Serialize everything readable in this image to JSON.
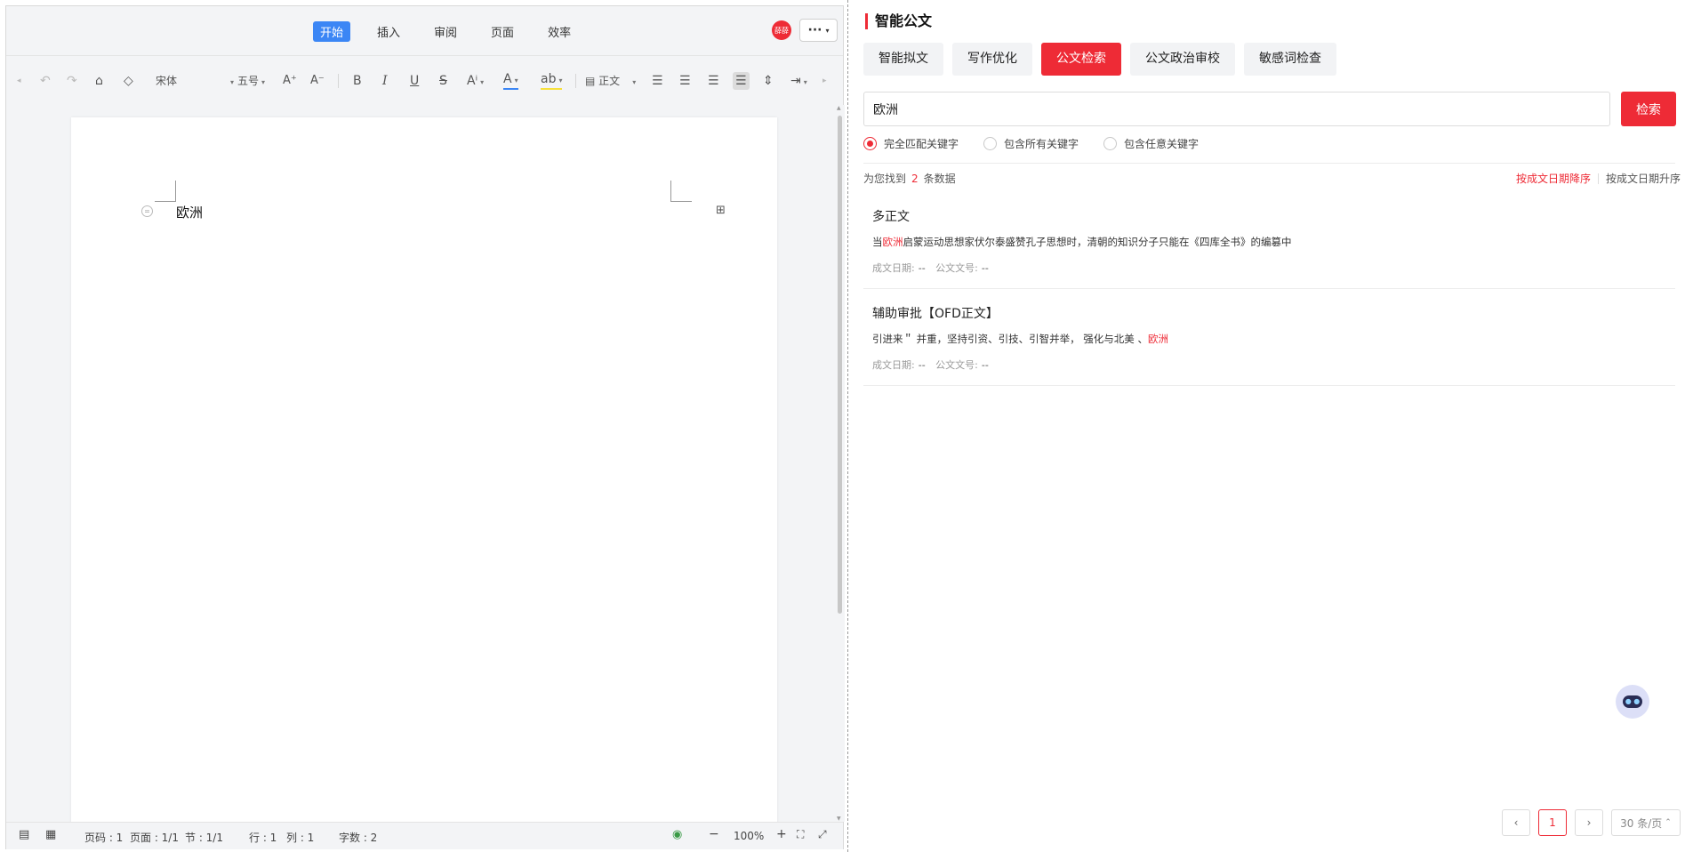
{
  "editor": {
    "menu_tabs": [
      "开始",
      "插入",
      "审阅",
      "页面",
      "效率"
    ],
    "avatar_text": "薛薛",
    "more_label": "···",
    "toolbar": {
      "font_name": "宋体",
      "font_size": "五号",
      "increase_font": "A⁺",
      "decrease_font": "A⁻",
      "bold": "B",
      "italic": "I",
      "underline": "U",
      "strike": "S",
      "superscript": "Aⁱ",
      "font_color": "A",
      "highlight": "ab",
      "style_label": "正文"
    },
    "document_text": "欧洲",
    "status": {
      "page_num": "页码 : 1",
      "pages": "页面 : 1/1",
      "section": "节 : 1/1",
      "row": "行 : 1",
      "col": "列 : 1",
      "word_count": "字数 : 2",
      "zoom_out": "−",
      "zoom": "100%",
      "zoom_in": "+"
    }
  },
  "panel": {
    "title": "智能公文",
    "tabs": [
      "智能拟文",
      "写作优化",
      "公文检索",
      "公文政治审校",
      "敏感词检查"
    ],
    "active_tab": "公文检索",
    "search": {
      "value": "欧洲",
      "button_label": "检索"
    },
    "match_modes": [
      "完全匹配关键字",
      "包含所有关键字",
      "包含任意关键字"
    ],
    "selected_mode": "完全匹配关键字",
    "result_prefix": "为您找到",
    "result_count": "2",
    "result_suffix": "条数据",
    "sort_desc": "按成文日期降序",
    "sort_asc": "按成文日期升序",
    "results": [
      {
        "title": "多正文",
        "snippet_before": "当",
        "snippet_hl": "欧洲",
        "snippet_after": "启蒙运动思想家伏尔泰盛赞孔子思想时，清朝的知识分子只能在《四库全书》的编篡中",
        "date_label": "成文日期:",
        "date_value": "--",
        "doc_no_label": "公文文号:",
        "doc_no_value": "--"
      },
      {
        "title": "辅助审批【OFD正文】",
        "snippet_before": "引进来＂ 并重，坚持引资、引技、引智并举， 强化与北美 、",
        "snippet_hl": "欧洲",
        "snippet_after": "",
        "date_label": "成文日期:",
        "date_value": "--",
        "doc_no_label": "公文文号:",
        "doc_no_value": "--"
      }
    ],
    "pagination": {
      "prev": "‹",
      "current": "1",
      "next": "›",
      "page_size": "30 条/页"
    },
    "colors": {
      "accent": "#ee2b36",
      "editor_active": "#3b86f5"
    }
  }
}
